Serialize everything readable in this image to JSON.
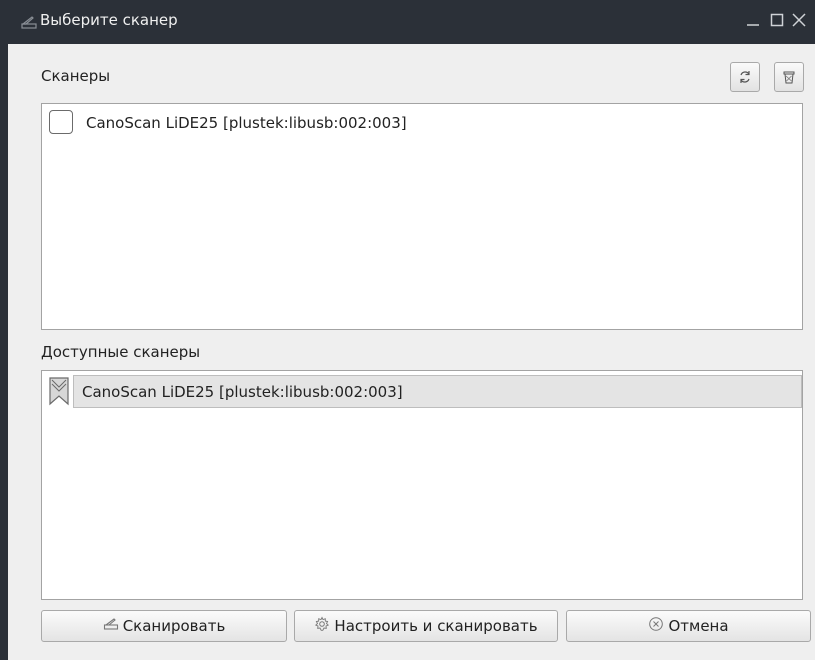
{
  "window": {
    "title": "Выберите сканер",
    "controls": {
      "minimize": "_",
      "maximize": "□",
      "close": "✕"
    }
  },
  "scanners": {
    "label": "Сканеры",
    "items": [
      {
        "name": "CanoScan LiDE25 [plustek:libusb:002:003]",
        "checked": false
      }
    ],
    "toolbar": {
      "refresh_icon": "refresh-icon",
      "delete_icon": "trash-icon"
    }
  },
  "available": {
    "label": "Доступные сканеры",
    "items": [
      {
        "name": "CanoScan LiDE25 [plustek:libusb:002:003]",
        "icon": "scanner-icon",
        "selected": true
      }
    ]
  },
  "buttons": {
    "scan": "Сканировать",
    "configure": "Настроить и сканировать",
    "cancel": "Отмена"
  },
  "colors": {
    "titlebar": "#2b3038",
    "window_bg": "#efefef",
    "selection": "#e4e4e4"
  }
}
